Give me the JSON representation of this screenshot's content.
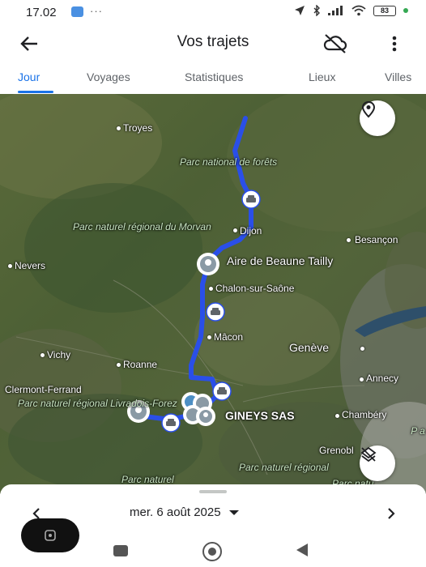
{
  "status_bar": {
    "time": "17.02",
    "dots": "···",
    "battery": "83"
  },
  "app_bar": {
    "title": "Vos trajets"
  },
  "tabs": [
    {
      "label": "Jour",
      "active": true
    },
    {
      "label": "Voyages",
      "active": false
    },
    {
      "label": "Statistiques",
      "active": false
    },
    {
      "label": "Lieux",
      "active": false
    },
    {
      "label": "Villes",
      "active": false
    }
  ],
  "map": {
    "places": {
      "troyes": "Troyes",
      "dijon": "Dijon",
      "besancon": "Besançon",
      "nevers": "Nevers",
      "aire_beaune": "Aire de Beaune Tailly",
      "chalon": "Chalon-sur-Saône",
      "macon": "Mâcon",
      "geneve": "Genève",
      "vichy": "Vichy",
      "roanne": "Roanne",
      "annecy": "Annecy",
      "clermont": "Clermont-Ferrand",
      "gineys": "GINEYS SAS",
      "chambery": "Chambéry",
      "grenoble": "Grenobl"
    },
    "parks": {
      "forets": "Parc national de forêts",
      "morvan": "Parc naturel régional du Morvan",
      "livradois": "Parc naturel régional Livradois-Forez",
      "bottom_left": "Parc naturel",
      "bottom_center": "Parc naturel régional",
      "bottom_right": "Parc natu",
      "right_edge": "P a"
    },
    "route_color": "#2a4fe8"
  },
  "sheet": {
    "date": "mer. 6 août 2025"
  }
}
